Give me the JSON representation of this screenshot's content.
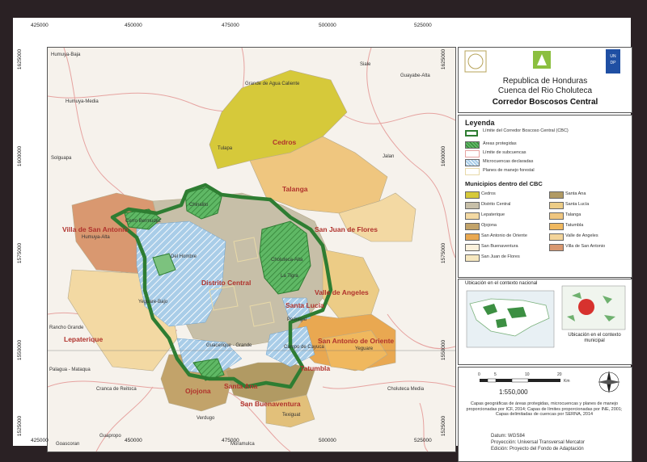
{
  "header": {
    "country": "Republica de Honduras",
    "basin": "Cuenca del Rio Choluteca",
    "corridor": "Corredor Boscosos Central"
  },
  "ticks": {
    "top": [
      "425000",
      "450000",
      "475000",
      "500000",
      "525000"
    ],
    "bottom": [
      "425000",
      "450000",
      "475000",
      "500000",
      "525000"
    ],
    "left": [
      "1625000",
      "1600000",
      "1575000",
      "1550000",
      "1525000"
    ],
    "right": [
      "1625000",
      "1600000",
      "1575000",
      "1550000",
      "1525000"
    ]
  },
  "places": {
    "humuya_baja": "Humuya-Baja",
    "humuya_media": "Humuya-Media",
    "grande_agua": "Grande de Agua Caliente",
    "siale": "Siale",
    "guayabe_alta": "Guayabe-Alta",
    "tulapa": "Tulapa",
    "jalan": "Jalan",
    "solguapa": "Solguapa",
    "humuya_alta": "Humuya-Alta",
    "cerro_bermudez": "Cerro Bermudez",
    "chinalito": "Chinalito",
    "del_hombre": "Del Hombre",
    "yeguare_bajo": "Yeguare-Bajo",
    "rancho_grande": "Rancho Grande",
    "guacerique_grande": "Guacerique - Grande",
    "palagua_mataqua": "Palagua - Mataqua",
    "cranca_reitoca": "Cranca de Reitoca",
    "verdugo": "Verdugo",
    "guapropo": "Guapropo",
    "goascoran": "Goascoran",
    "moramulca": "Moramulca",
    "texiguat": "Texiguat",
    "yeguare": "Yeguare",
    "choluteca_media": "Choluteca Media",
    "cholutega_alta": "Choluteca-Alta",
    "la_tigra": "La Tigra",
    "pedregal": "Pedregal",
    "campo_cayuca": "Campo de Cayuca"
  },
  "municipalities": {
    "cedros": "Cedros",
    "talanga": "Talanga",
    "villa_san_antonio": "Villa de San Antonio",
    "san_juan_flores": "San Juan de Flores",
    "distrito_central": "Distrito Central",
    "santa_lucia": "Santa Lucía",
    "valle_angeles": "Valle de Angeles",
    "lepaterique": "Lepaterique",
    "san_antonio_oriente": "San Antonio de Oriente",
    "tatumbla": "Tatumbla",
    "ojojona": "Ojojona",
    "santa_ana": "Santa Ana",
    "san_buenaventura": "San Buenaventura"
  },
  "legend": {
    "title": "Leyenda",
    "items": [
      "Límite del Corredor Boscoso Central (CBC)",
      "Áreas protegidas",
      "Límite de subcuencas",
      "Microcuencas declaradas",
      "Planes de manejo forestal"
    ],
    "muni_title": "Municipios dentro del CBC",
    "muni_left": [
      "Cedros",
      "Distrito Central",
      "Lepaterique",
      "Ojojona",
      "San Antonio de Oriente",
      "San Buenaventura",
      "San Juan de Flores"
    ],
    "muni_right": [
      "Santa Ana",
      "Santa Lucía",
      "Talanga",
      "Tatumbla",
      "Valle de Angeles",
      "Villa de San Antonio"
    ]
  },
  "context": {
    "national_label": "Ubicación en el contexto nacional",
    "municipal_label": "Ubicación en el contexto municipal"
  },
  "scale": {
    "ticks": [
      "0",
      "5",
      "10",
      "20"
    ],
    "unit": "Km",
    "ratio": "1:550,000"
  },
  "notes": {
    "sources": "Capas geográficas de áreas protegidas, microcuencas y planes de manejo proporcionadas por ICF, 2014; Capas de límites proporcionadas por INE, 2001; Capas delimitadas de cuencas por SERNA, 2014",
    "datum": "Datum: WGS84",
    "projection": "Proyección: Universal Transversal Mercator",
    "edition": "Edición: Proyecto del Fondo de Adaptación"
  },
  "colors": {
    "corridor": "#2e7d32",
    "protected": "#4caf50",
    "microcuenca": "#9dc3e6",
    "cedros": "#d6c93a",
    "distrito": "#c7bfa8",
    "lepaterique": "#f3d9a3",
    "ojojona": "#c2a36a",
    "san_antonio_oriente": "#e9a851",
    "santa_ana": "#b19a63",
    "talanga": "#efc67f",
    "villa": "#d99870"
  }
}
